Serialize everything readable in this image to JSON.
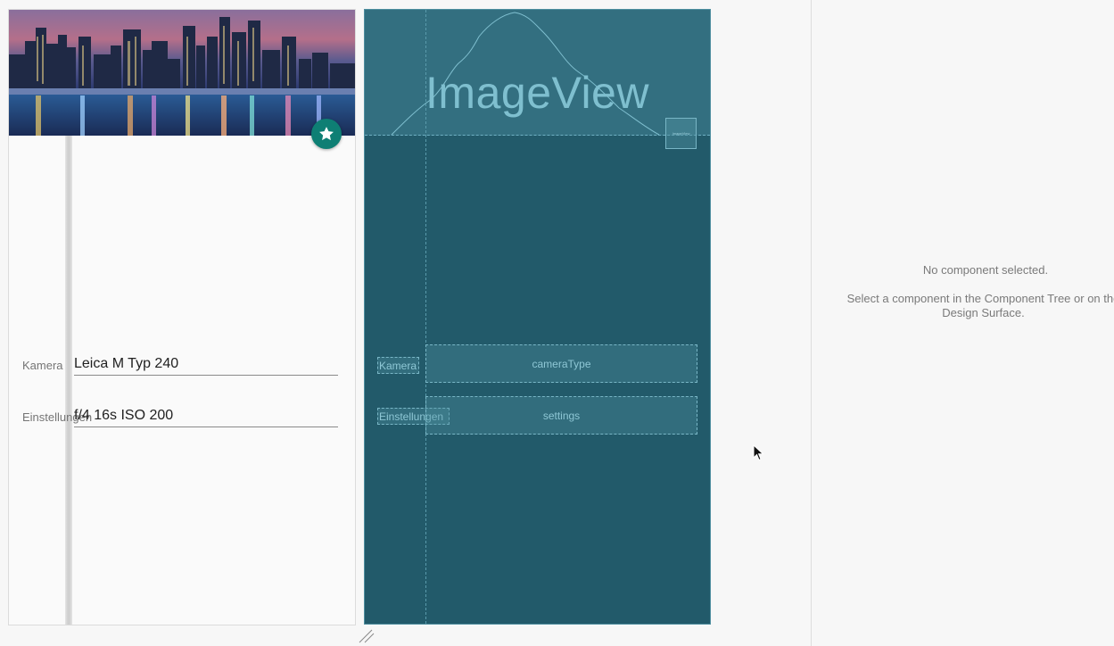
{
  "design_preview": {
    "fields": [
      {
        "label": "Kamera",
        "value": "Leica M Typ 240"
      },
      {
        "label": "Einstellungen",
        "value": "f/4 16s ISO 200"
      }
    ],
    "fab_icon": "star-icon",
    "accent_color": "#0e7f74"
  },
  "blueprint": {
    "image_view_label": "ImageView",
    "fab_label": "ImageView",
    "label_kamera": "Kamera",
    "label_einstellungen": "Einstellungen",
    "camera_type": "cameraType",
    "settings": "settings",
    "background_color": "#225a6a"
  },
  "properties_panel": {
    "title": "No component selected.",
    "hint": "Select a component in the Component Tree or on the Design Surface."
  }
}
